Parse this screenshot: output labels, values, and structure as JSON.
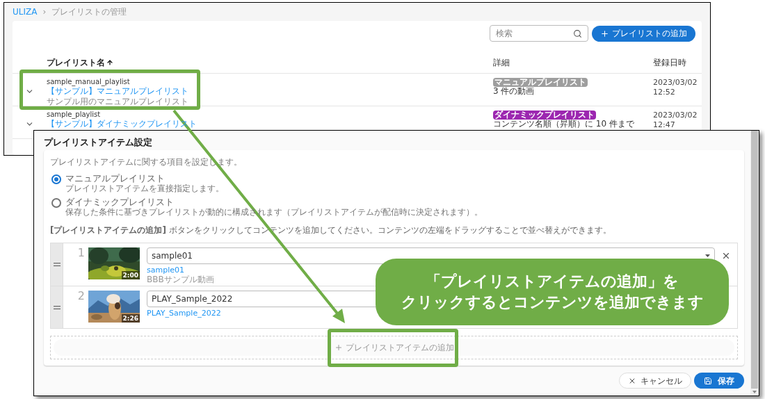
{
  "back_window": {
    "breadcrumb_separator": "›",
    "breadcrumb": [
      {
        "label": "ULIZA",
        "kind": "link"
      },
      {
        "label": "プレイリストの管理",
        "kind": "current"
      }
    ],
    "search": {
      "placeholder": "検索"
    },
    "add_button": "プレイリストの追加",
    "columns": [
      "プレイリスト名",
      "詳細",
      "登録日時"
    ],
    "rows": [
      {
        "key": "sample_manual_playlist",
        "title": "【サンプル】マニュアルプレイリスト",
        "description": "サンプル用のマニュアルプレイリスト",
        "tag": "マニュアルプレイリスト",
        "color": "#9e9e9e",
        "detail": "3 件の動画",
        "date": "2023/03/02",
        "time": "12:52"
      },
      {
        "key": "sample_playlist",
        "title": "【サンプル】ダイナミックプレイリスト",
        "tag": "ダイナミックプレイリスト",
        "color": "#9c27b0",
        "detail": "コンテンツ名順（昇順）に 10 件まで",
        "date": "2023/03/02",
        "time": "12:47"
      }
    ]
  },
  "dialog": {
    "title": "プレイリストアイテム設定",
    "intro": "プレイリストアイテムに関する項目を設定します。",
    "options": [
      {
        "label": "マニュアルプレイリスト",
        "description": "プレイリストアイテムを直接指定します。",
        "selected": true
      },
      {
        "label": "ダイナミックプレイリスト",
        "description": "保存した条件に基づきプレイリストが動的に構成されます（プレイリストアイテムが配信時に決定されます）。",
        "selected": false
      }
    ],
    "instruction": "**[プレイリストアイテムの追加]** ボタンをクリックしてコンテンツを追加してください。コンテンツの左端をドラッグすることで並べ替えができます。",
    "items": [
      {
        "number": "1",
        "value": "sample01",
        "link": "sample01",
        "subtitle": "BBBサンプル動画",
        "duration": "2:00",
        "has_dropdown": true,
        "removable": true
      },
      {
        "number": "2",
        "value": "PLAY_Sample_2022",
        "link": "PLAY_Sample_2022",
        "duration": "2:26"
      }
    ],
    "add_item_button": "プレイリストアイテムの追加",
    "buttons": [
      {
        "label": "キャンセル",
        "kind": "cancel"
      },
      {
        "label": "保存",
        "kind": "save"
      }
    ]
  },
  "callout": {
    "lines": [
      "「プレイリストアイテムの追加」を",
      "クリックするとコンテンツを追加できます"
    ]
  }
}
